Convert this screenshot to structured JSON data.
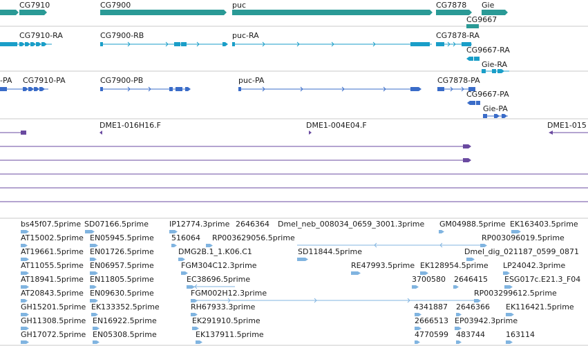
{
  "tracks": {
    "genes": {
      "color": "#2a9a96",
      "labels": [
        "CG7910",
        "CG7900",
        "puc",
        "CG7878",
        "Gie",
        "CG9667"
      ]
    },
    "transcripts": {
      "color": "#1a9ec8",
      "labels": [
        "CG7910-RA",
        "CG7900-RB",
        "puc-RA",
        "CG7878-RA",
        "CG9667-RA",
        "Gie-RA"
      ]
    },
    "proteins": {
      "color": "#3a6cc8",
      "labels": [
        "-PA",
        "CG7910-PA",
        "CG7900-PB",
        "puc-PA",
        "CG7878-PA",
        "CG9667-PA",
        "Gie-PA"
      ]
    },
    "clones": {
      "color": "#6a4aa0",
      "labels": [
        "DME1-016H16.F",
        "DME1-004E04.F",
        "DME1-015"
      ]
    },
    "ests": {
      "color": "#80b4e0",
      "labels": [
        "bs45f07.5prime",
        "SD07166.5prime",
        "IP12774.3prime",
        "2646364",
        "Dmel_neb_008034_0659_3001.3prime",
        "GM04988.5prime",
        "EK163403.5prime",
        "AT15002.5prime",
        "EN05945.5prime",
        "516064",
        "RP003629056.5prime",
        "RP003096019.5prime",
        "AT19661.5prime",
        "EN01726.5prime",
        "DMG2B.1_1.K06.C1",
        "SD11844.5prime",
        "Dmel_dig_021187_0599_0871",
        "AT11055.5prime",
        "EN06957.5prime",
        "FGM304C12.3prime",
        "RE47993.5prime",
        "EK128954.5prime",
        "LP24042.3prime",
        "AT18941.5prime",
        "EN11805.5prime",
        "EC38696.5prime",
        "3700580",
        "2646415",
        "ESG017c.E21.3_F04",
        "AT20843.5prime",
        "EN09630.5prime",
        "FGM002H12.3prime",
        "RP003299612.5prime",
        "GH15201.5prime",
        "EK133352.5prime",
        "RH67933.3prime",
        "4341887",
        "2646366",
        "EK116421.5prime",
        "GH11308.5prime",
        "EN16922.5prime",
        "EK291910.5prime",
        "2666513",
        "EP03942.3prime",
        "GH17072.5prime",
        "EN05308.5prime",
        "EK137911.5prime",
        "4770599",
        "483744",
        "163114"
      ]
    }
  }
}
